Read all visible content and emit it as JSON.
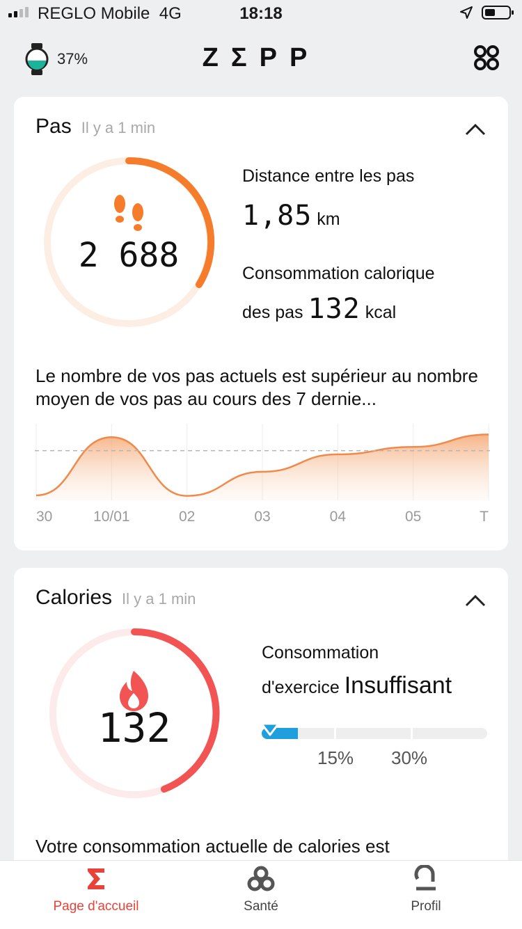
{
  "status": {
    "carrier": "REGLO Mobile",
    "network": "4G",
    "time": "18:18"
  },
  "header": {
    "watch_battery": "37%",
    "logo": "ZΣPP"
  },
  "steps_card": {
    "title": "Pas",
    "updated": "Il y a 1 min",
    "steps": "2 688",
    "distance_label": "Distance entre les pas",
    "distance_value": "1,85",
    "distance_unit": "km",
    "cal_label_1": "Consommation calorique",
    "cal_label_2": "des pas",
    "cal_value": "132",
    "cal_unit": "kcal",
    "description": "Le nombre de vos pas actuels est supérieur au nombre moyen de vos pas au cours des 7 dernie...",
    "accent": "#f57c2b"
  },
  "chart_data": {
    "type": "area",
    "categories": [
      "30",
      "10/01",
      "02",
      "03",
      "04",
      "05",
      "T"
    ],
    "values": [
      200,
      2540,
      180,
      1150,
      1850,
      2150,
      2650
    ],
    "average": 2000,
    "ylim": [
      0,
      2800
    ],
    "grid": true
  },
  "calories_card": {
    "title": "Calories",
    "updated": "Il y a 1 min",
    "value": "132",
    "label_1": "Consommation",
    "label_2": "d'exercice",
    "level": "Insuffisant",
    "progress_fraction": 0.16,
    "marks": [
      "15%",
      "30%"
    ],
    "description": "Votre consommation actuelle de calories est",
    "accent": "#f25353"
  },
  "tabs": [
    {
      "label": "Page d'accueil",
      "icon": "sigma-icon",
      "active": true
    },
    {
      "label": "Santé",
      "icon": "health-icon",
      "active": false
    },
    {
      "label": "Profil",
      "icon": "profile-icon",
      "active": false
    }
  ]
}
